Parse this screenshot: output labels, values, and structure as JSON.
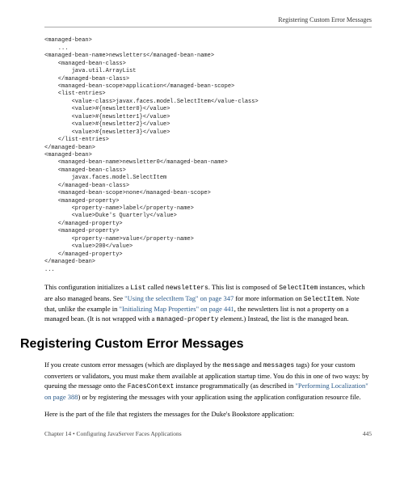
{
  "header": {
    "running_head": "Registering Custom Error Messages"
  },
  "code": "<managed-bean>\n    ...\n<managed-bean-name>newsletters</managed-bean-name>\n    <managed-bean-class>\n        java.util.ArrayList\n    </managed-bean-class>\n    <managed-bean-scope>application</managed-bean-scope>\n    <list-entries>\n        <value-class>javax.faces.model.SelectItem</value-class>\n        <value>#{newsletter0}</value>\n        <value>#{newsletter1}</value>\n        <value>#{newsletter2}</value>\n        <value>#{newsletter3}</value>\n    </list-entries>\n</managed-bean>\n<managed-bean>\n    <managed-bean-name>newsletter0</managed-bean-name>\n    <managed-bean-class>\n        javax.faces.model.SelectItem\n    </managed-bean-class>\n    <managed-bean-scope>none</managed-bean-scope>\n    <managed-property>\n        <property-name>label</property-name>\n        <value>Duke's Quarterly</value>\n    </managed-property>\n    <managed-property>\n        <property-name>value</property-name>\n        <value>200</value>\n    </managed-property>\n</managed-bean>\n...",
  "para1": {
    "t1": "This configuration initializes a ",
    "c1": "List",
    "t2": " called ",
    "c2": "newsletters",
    "t3": ". This list is composed of ",
    "c3": "SelectItem",
    "t4": " instances, which are also managed beans. See ",
    "l1": "\"Using the selectItem Tag\" on page 347",
    "t5": " for more information on ",
    "c4": "SelectItem",
    "t6": ". Note that, unlike the example in ",
    "l2": "\"Initializing Map Properties\" on page 441",
    "t7": ", the newsletters list is not a property on a managed bean. (It is not wrapped with a ",
    "c5": "managed-property",
    "t8": " element.) Instead, the list is the managed bean."
  },
  "heading": "Registering Custom Error Messages",
  "para2": {
    "t1": "If you create custom error messages (which are displayed by the ",
    "c1": "message",
    "t2": " and ",
    "c2": "messages",
    "t3": " tags) for your custom converters or validators, you must make them available at application startup time. You do this in one of two ways: by queuing the message onto the ",
    "c3": "FacesContext",
    "t4": " instance programmatically (as described in ",
    "l1": "\"Performing Localization\" on page 388",
    "t5": ") or by registering the messages with your application using the application configuration resource file."
  },
  "para3": "Here is the part of the file that registers the messages for the Duke's Bookstore application:",
  "footer": {
    "left": "Chapter 14 • Configuring JavaServer Faces Applications",
    "right": "445"
  }
}
